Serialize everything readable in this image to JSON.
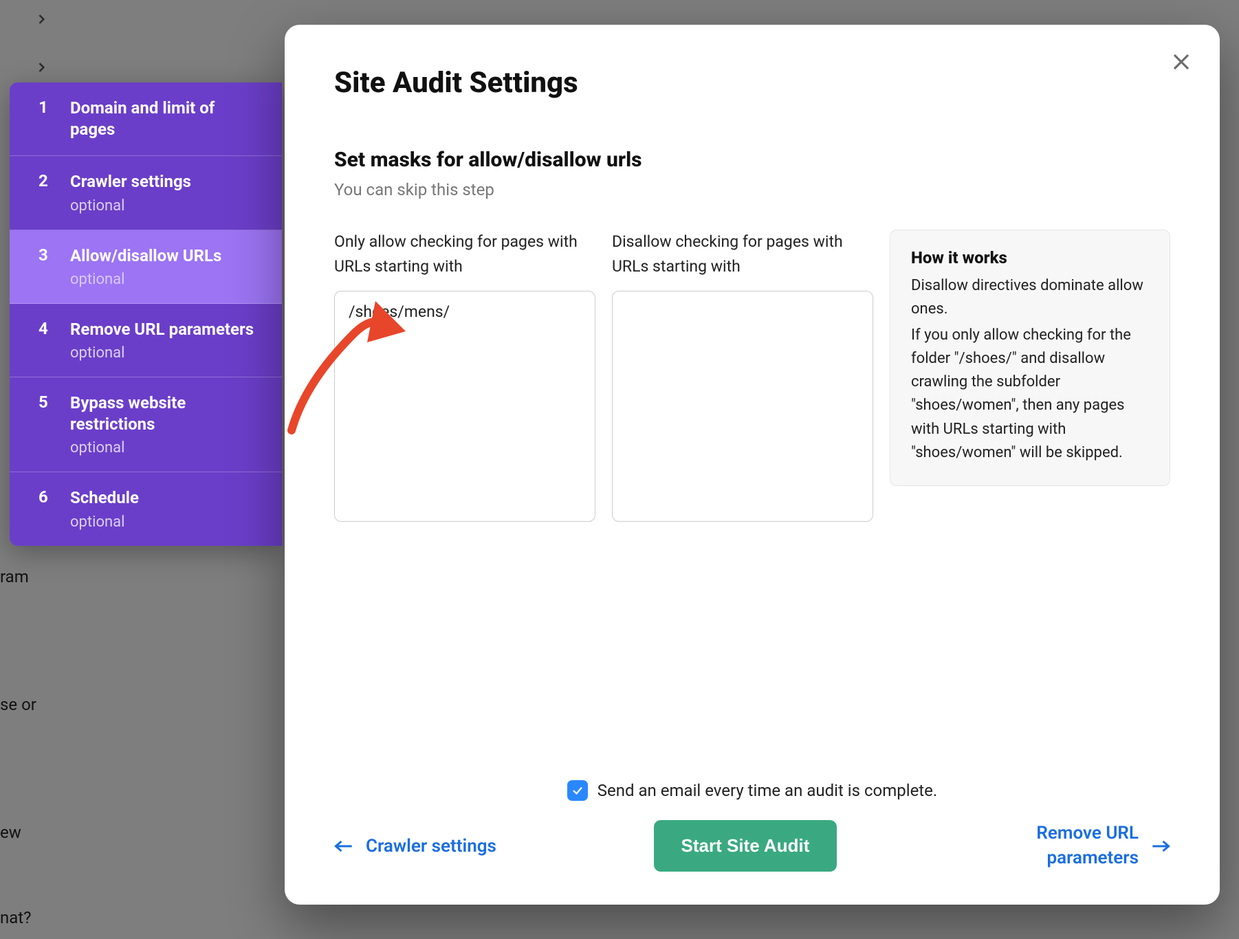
{
  "bg_side_texts": [
    "ram",
    "se or",
    "ew",
    "nat?"
  ],
  "sidebar": [
    {
      "num": "1",
      "title": "Domain and limit of pages",
      "opt": null
    },
    {
      "num": "2",
      "title": "Crawler settings",
      "opt": "optional"
    },
    {
      "num": "3",
      "title": "Allow/disallow URLs",
      "opt": "optional",
      "active": true
    },
    {
      "num": "4",
      "title": "Remove URL parameters",
      "opt": "optional"
    },
    {
      "num": "5",
      "title": "Bypass website restrictions",
      "opt": "optional"
    },
    {
      "num": "6",
      "title": "Schedule",
      "opt": "optional"
    }
  ],
  "modal": {
    "title": "Site Audit Settings",
    "subtitle": "Set masks for allow/disallow urls",
    "skip": "You can skip this step",
    "allow_label": "Only allow checking for pages with URLs starting with",
    "disallow_label": "Disallow checking for pages with URLs starting with",
    "allow_value": "/shoes/mens/",
    "disallow_value": "",
    "info_title": "How it works",
    "info_p1": "Disallow directives dominate allow ones.",
    "info_p2": "If you only allow checking for the folder \"/shoes/\" and disallow crawling the subfolder \"shoes/women\", then any pages with URLs starting with \"shoes/women\" will be skipped."
  },
  "footer": {
    "email": "Send an email every time an audit is complete.",
    "prev": "Crawler settings",
    "start": "Start Site Audit",
    "next": "Remove URL parameters"
  }
}
